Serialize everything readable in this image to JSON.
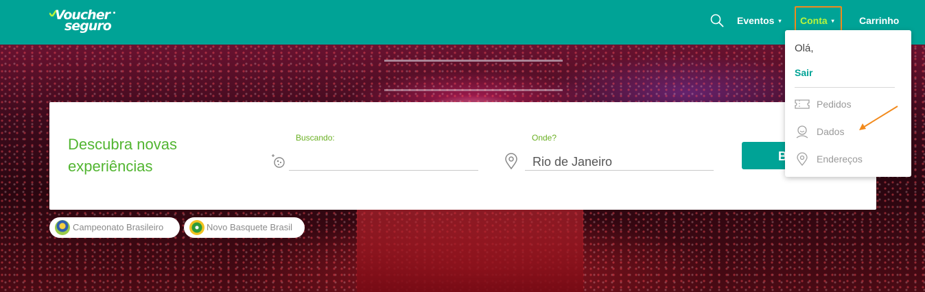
{
  "header": {
    "logo_line1": "Voucher",
    "logo_line2": "seguro",
    "nav": {
      "search_icon": "search-icon",
      "eventos": "Eventos",
      "conta": "Conta",
      "carrinho": "Carrinho",
      "caret": "▾"
    }
  },
  "account_menu": {
    "greeting": "Olá,",
    "logout": "Sair",
    "items": [
      {
        "label": "Pedidos",
        "icon": "ticket-icon"
      },
      {
        "label": "Dados",
        "icon": "user-face-icon"
      },
      {
        "label": "Endereços",
        "icon": "location-pin-icon"
      }
    ]
  },
  "search_card": {
    "title": "Descubra novas experiências",
    "search_label": "Buscando:",
    "search_value": "",
    "location_label": "Onde?",
    "location_value": "Rio de Janeiro",
    "button_label": "B"
  },
  "chips": [
    {
      "label": "Campeonato Brasileiro",
      "icon": "trophy-icon"
    },
    {
      "label": "Novo Basquete Brasil",
      "icon": "nbb-logo-icon"
    }
  ],
  "colors": {
    "primary": "#00a396",
    "accent_green": "#52b531",
    "active_nav": "#b8f53c",
    "highlight": "#f28a1c"
  }
}
